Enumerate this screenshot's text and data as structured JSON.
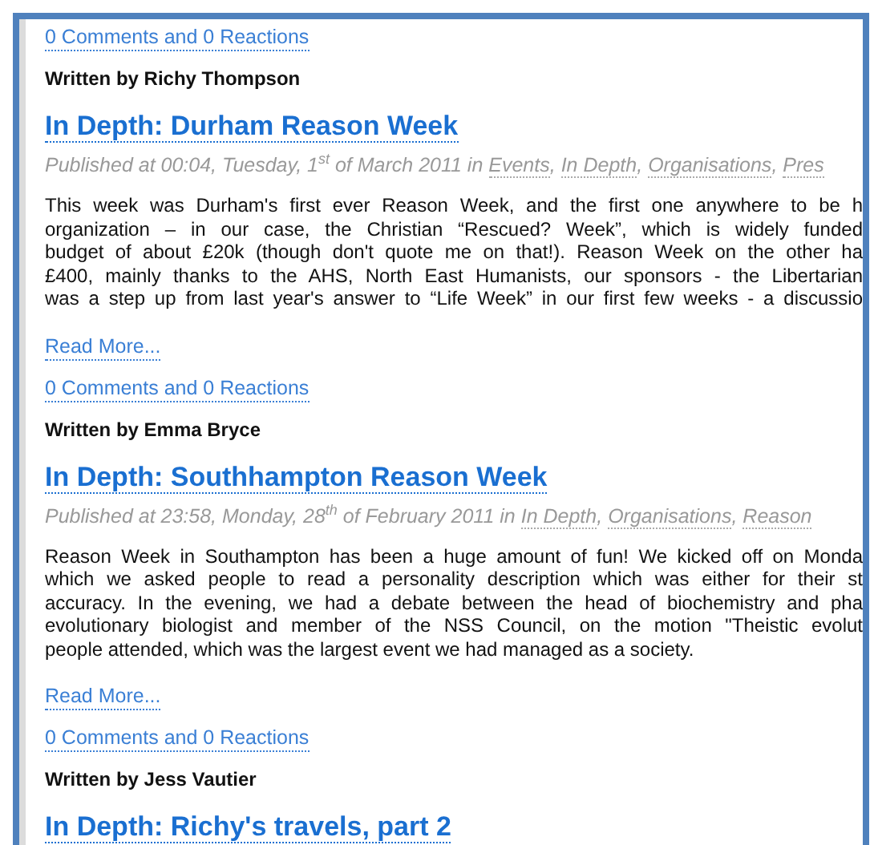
{
  "leading_comments_link": "0 Comments and 0 Reactions",
  "posts": [
    {
      "author": "Written by Richy Thompson",
      "title": "In Depth: Durham Reason Week",
      "published": "Published at 00:04, Tuesday, 1$^{st}$ of March 2011 in",
      "categories": [
        {
          "label": "Events",
          "after": ","
        },
        {
          "label": "In Depth",
          "after": ","
        },
        {
          "label": "Organisations",
          "after": ","
        },
        {
          "label": "Pres"
        }
      ],
      "body_lines": [
        "This week was Durham's first ever Reason Week, and the first one anywhere to be h",
        "organization – in our case, the Christian “Rescued? Week”, which is widely funded",
        "budget of about £20k (though don't quote me on that!). Reason Week on the other ha",
        "£400, mainly thanks to the AHS, North East Humanists, our sponsors - the Libertarian",
        "was a step up from last year's answer to “Life Week” in our first few weeks - a discussio"
      ],
      "paragraph_ends": false,
      "read_more": "Read More...",
      "comments": "0 Comments and 0 Reactions"
    },
    {
      "author": "Written by Emma Bryce",
      "title": "In Depth: Southhampton Reason Week",
      "published": "Published at 23:58, Monday, 28$^{th}$ of February 2011 in",
      "categories": [
        {
          "label": "In Depth",
          "after": ","
        },
        {
          "label": "Organisations",
          "after": ","
        },
        {
          "label": "Reason"
        }
      ],
      "body_lines": [
        "Reason Week in Southampton has been a huge amount of fun! We kicked off on Monda",
        "which we asked people to read a personality description which was either for their st",
        "accuracy. In the evening, we had a debate between the head of biochemistry and pha",
        "evolutionary biologist and member of the NSS Council, on the motion \"Theistic evolut",
        "people attended, which was the largest event we had managed as a society."
      ],
      "paragraph_ends": true,
      "read_more": "Read More...",
      "comments": "0 Comments and 0 Reactions"
    },
    {
      "author": "Written by Jess Vautier",
      "title": "In Depth: Richy's travels, part 2"
    }
  ]
}
